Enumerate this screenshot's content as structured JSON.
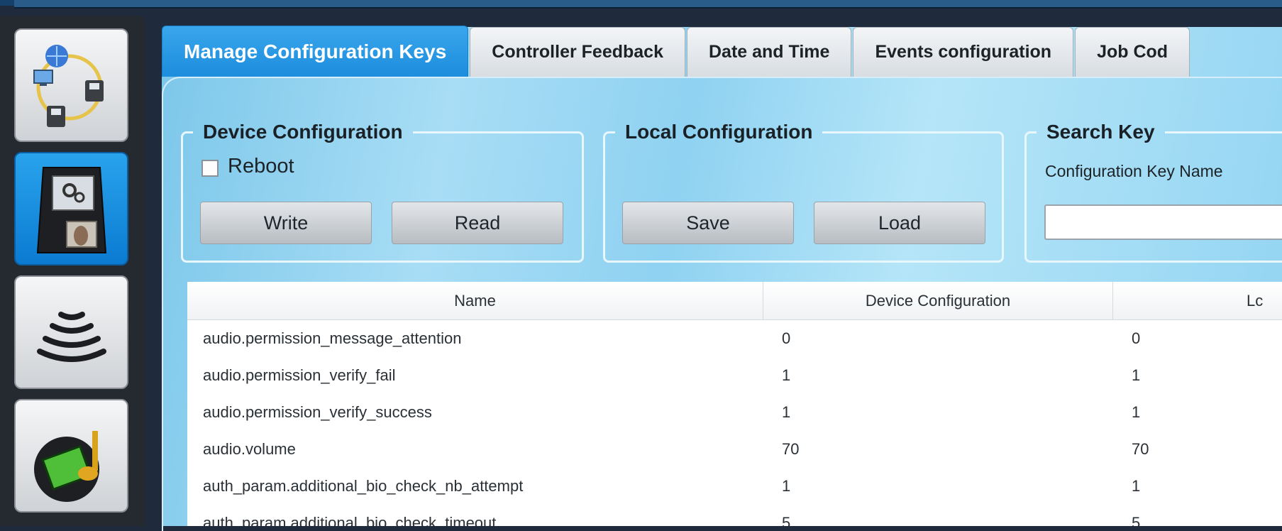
{
  "sidebar": {
    "items": [
      {
        "icon": "network-devices-icon",
        "active": false
      },
      {
        "icon": "terminal-config-icon",
        "active": true
      },
      {
        "icon": "wireless-signal-icon",
        "active": false
      },
      {
        "icon": "multimedia-icon",
        "active": false
      }
    ]
  },
  "tabs": [
    {
      "label": "Manage Configuration Keys",
      "active": true
    },
    {
      "label": "Controller Feedback",
      "active": false
    },
    {
      "label": "Date and Time",
      "active": false
    },
    {
      "label": "Events configuration",
      "active": false
    },
    {
      "label": "Job Cod",
      "active": false
    }
  ],
  "device_config": {
    "legend": "Device Configuration",
    "reboot_label": "Reboot",
    "reboot_checked": false,
    "write_label": "Write",
    "read_label": "Read"
  },
  "local_config": {
    "legend": "Local Configuration",
    "save_label": "Save",
    "load_label": "Load"
  },
  "search": {
    "legend": "Search Key",
    "field_label": "Configuration Key Name",
    "value": ""
  },
  "table": {
    "columns": [
      "Name",
      "Device Configuration",
      "Lc"
    ],
    "rows": [
      [
        "audio.permission_message_attention",
        "0",
        "0"
      ],
      [
        "audio.permission_verify_fail",
        "1",
        "1"
      ],
      [
        "audio.permission_verify_success",
        "1",
        "1"
      ],
      [
        "audio.volume",
        "70",
        "70"
      ],
      [
        "auth_param.additional_bio_check_nb_attempt",
        "1",
        "1"
      ],
      [
        "auth_param.additional_bio_check_timeout",
        "5",
        "5"
      ]
    ]
  }
}
